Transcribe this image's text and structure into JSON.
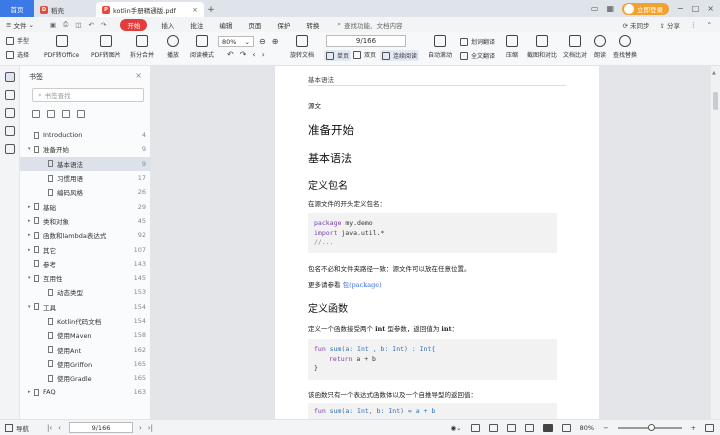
{
  "titlebar": {
    "home_tab": "首页",
    "daoke_tab": "稻壳",
    "doc_tab": "kotlin手册精通版.pdf",
    "login_label": "立即登录",
    "window_controls": [
      "minimize-icon",
      "maximize-icon",
      "close-icon"
    ]
  },
  "menubar": {
    "file": "文件",
    "items": [
      "开始",
      "插入",
      "批注",
      "编辑",
      "页面",
      "保护",
      "转换"
    ],
    "active": "开始",
    "search_placeholder": "查找功能、文档内容",
    "right": [
      "未同步",
      "分享"
    ]
  },
  "toolbar": {
    "hand": "手型",
    "select": "选择",
    "pdf_to_office": "PDF转Office",
    "pdf_to_image": "PDF转图片",
    "split_merge": "拆分合并",
    "play": "播放",
    "reading_mode": "阅读模式",
    "zoom": "80%",
    "rotate": "旋转文档",
    "single_page": "单页",
    "double_page": "双页",
    "continuous": "连续阅读",
    "auto_scroll": "自动滚动",
    "translate": "划词翻译",
    "full_translate": "全文翻译",
    "compress": "压缩",
    "screenshot_compare": "截图和对比",
    "text_compare": "文档比对",
    "read_aloud": "朗读",
    "find_replace": "查找替换",
    "page_indicator": "9/166"
  },
  "sidebar": {
    "title": "书签",
    "search_placeholder": "书签查找",
    "bookmarks": [
      {
        "label": "Introduction",
        "page": "4",
        "level": 0,
        "arrow": ""
      },
      {
        "label": "准备开始",
        "page": "9",
        "level": 0,
        "arrow": "▾"
      },
      {
        "label": "基本语法",
        "page": "9",
        "level": 1,
        "arrow": ""
      },
      {
        "label": "习惯用语",
        "page": "17",
        "level": 1,
        "arrow": ""
      },
      {
        "label": "编码风格",
        "page": "26",
        "level": 1,
        "arrow": ""
      },
      {
        "label": "基础",
        "page": "29",
        "level": 0,
        "arrow": "▸"
      },
      {
        "label": "类和对象",
        "page": "45",
        "level": 0,
        "arrow": "▸"
      },
      {
        "label": "函数和lambda表达式",
        "page": "92",
        "level": 0,
        "arrow": "▸"
      },
      {
        "label": "其它",
        "page": "107",
        "level": 0,
        "arrow": "▸"
      },
      {
        "label": "参考",
        "page": "143",
        "level": 0,
        "arrow": ""
      },
      {
        "label": "互用性",
        "page": "145",
        "level": 0,
        "arrow": "▾"
      },
      {
        "label": "动态类型",
        "page": "153",
        "level": 1,
        "arrow": ""
      },
      {
        "label": "工具",
        "page": "154",
        "level": 0,
        "arrow": "▾"
      },
      {
        "label": "Kotlin代码文档",
        "page": "154",
        "level": 1,
        "arrow": ""
      },
      {
        "label": "使用Maven",
        "page": "158",
        "level": 1,
        "arrow": ""
      },
      {
        "label": "使用Ant",
        "page": "162",
        "level": 1,
        "arrow": ""
      },
      {
        "label": "使用Griffon",
        "page": "165",
        "level": 1,
        "arrow": ""
      },
      {
        "label": "使用Gradle",
        "page": "165",
        "level": 1,
        "arrow": ""
      },
      {
        "label": "FAQ",
        "page": "163",
        "level": 0,
        "arrow": "▸"
      }
    ],
    "selected_index": 2
  },
  "document": {
    "header": "基本语法",
    "crumb": "源文",
    "h1": "准备开始",
    "h2_a": "基本语法",
    "h2_b": "定义包名",
    "p1": "在源文件的开头定义包名：",
    "code1": {
      "kw1": "package",
      "rest1": " my.demo",
      "kw2": "import",
      "rest2": " java.util.*",
      "c3": "//..."
    },
    "p2": "包名不必和文件夹路径一致：源文件可以放在任意位置。",
    "p3_prefix": "更多请参看 ",
    "p3_link": "包(package)",
    "h2_c": "定义函数",
    "p4_pre": "定义一个函数接受两个 ",
    "p4_int": "int",
    "p4_mid": " 型参数，返回值为 ",
    "p4_int2": "int",
    "p4_end": "：",
    "code2": {
      "l1_kw": "fun",
      "l1_fn": " sum",
      "l1_rest": "(a: Int , b: Int) : Int{",
      "l2_kw": "return",
      "l2_rest": " a + b",
      "l3": "}"
    },
    "p5": "该函数只有一个表达式函数体以及一个自推导型的返回值：",
    "code3": {
      "kw": "fun",
      "fn": " sum",
      "rest": "(a: Int, b: Int) = a + b"
    }
  },
  "statusbar": {
    "nav_label": "导航",
    "page": "9/166",
    "zoom": "80%"
  }
}
